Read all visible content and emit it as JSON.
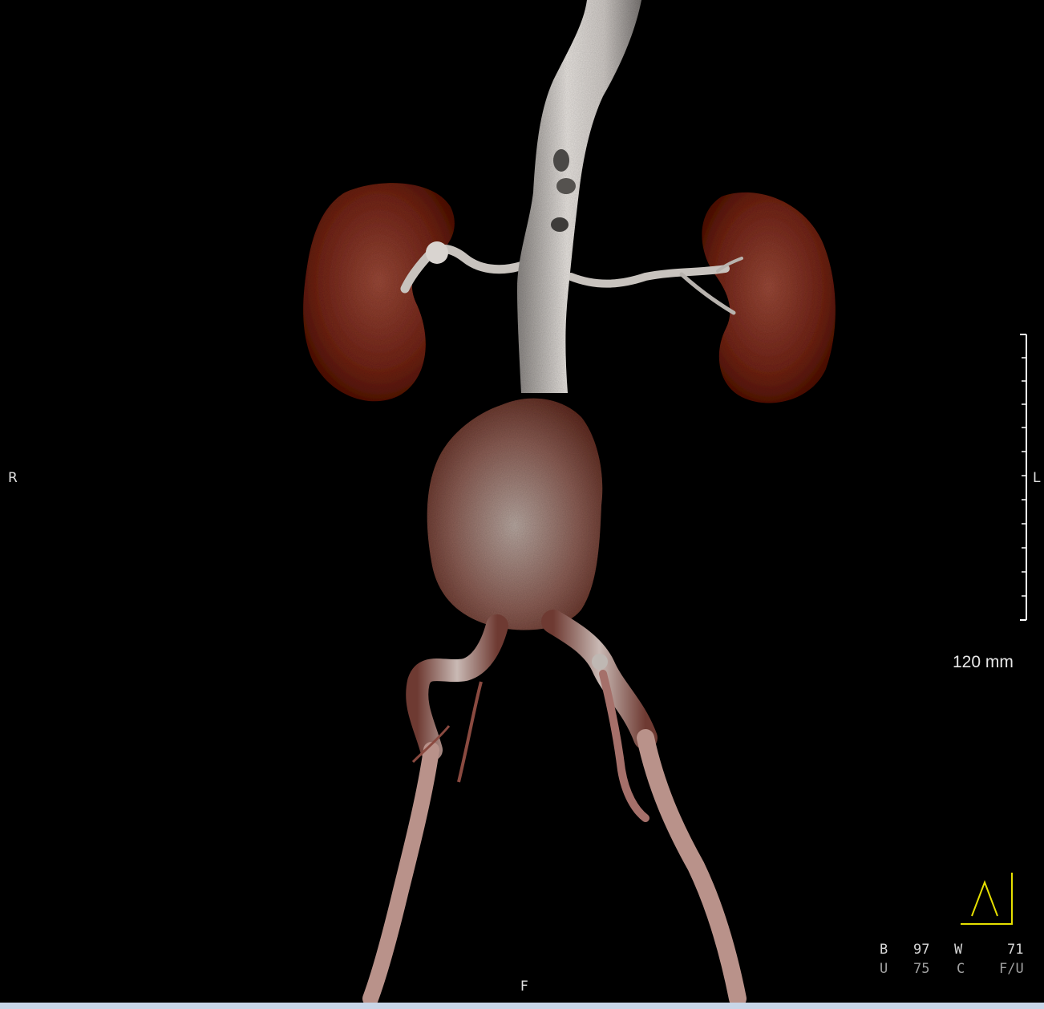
{
  "viewer": {
    "orientation": {
      "right": "R",
      "left": "L",
      "foot": "F"
    },
    "scale": {
      "label": "120 mm"
    },
    "readouts": {
      "b_label": "B",
      "b_value": "97",
      "w_label": "W",
      "w_value": "71",
      "row2_a": "U",
      "row2_b": "75",
      "row2_c": "C",
      "row2_d": "F/U"
    },
    "colors": {
      "background": "#000000",
      "vessel": "#d9d4d0",
      "kidney": "#7a2a1e",
      "scale": "#ffffff",
      "orientation_marker": "#e6e000"
    }
  }
}
